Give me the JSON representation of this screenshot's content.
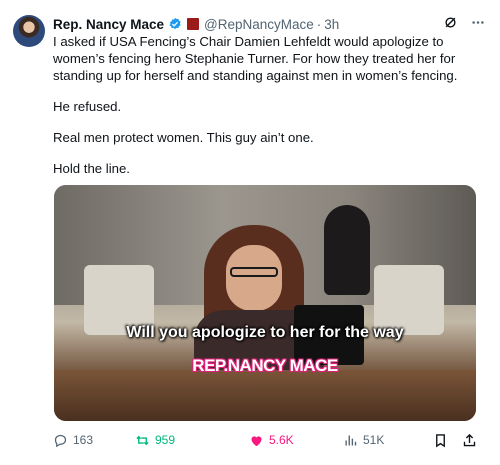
{
  "author": {
    "name": "Rep. Nancy Mace",
    "handle": "@RepNancyMace",
    "separator": "·",
    "time": "3h"
  },
  "post": {
    "paragraphs": [
      "I asked if USA Fencing’s Chair Damien Lehfeldt would apologize to women’s fencing hero Stephanie Turner. For how they treated her for standing up for herself and standing against men in women’s fencing.",
      "He refused.",
      "Real men protect women. This guy ain’t one.",
      "Hold the line."
    ]
  },
  "media": {
    "caption": "Will you apologize to her for the way",
    "lower_third": "REP.NANCY MACE"
  },
  "actions": {
    "replies": "163",
    "reposts": "959",
    "likes": "5.6K",
    "views": "51K"
  },
  "icons": [
    "verified-badge-icon",
    "flag-icon",
    "grok-icon",
    "more-icon",
    "reply-icon",
    "repost-icon",
    "like-icon",
    "views-icon",
    "bookmark-icon",
    "share-icon"
  ],
  "colors": {
    "text": "#0f1419",
    "muted": "#536471",
    "verified": "#1d9bf0",
    "repost": "#00ba7c",
    "like": "#f91880",
    "lower_third": "#e0217a"
  }
}
